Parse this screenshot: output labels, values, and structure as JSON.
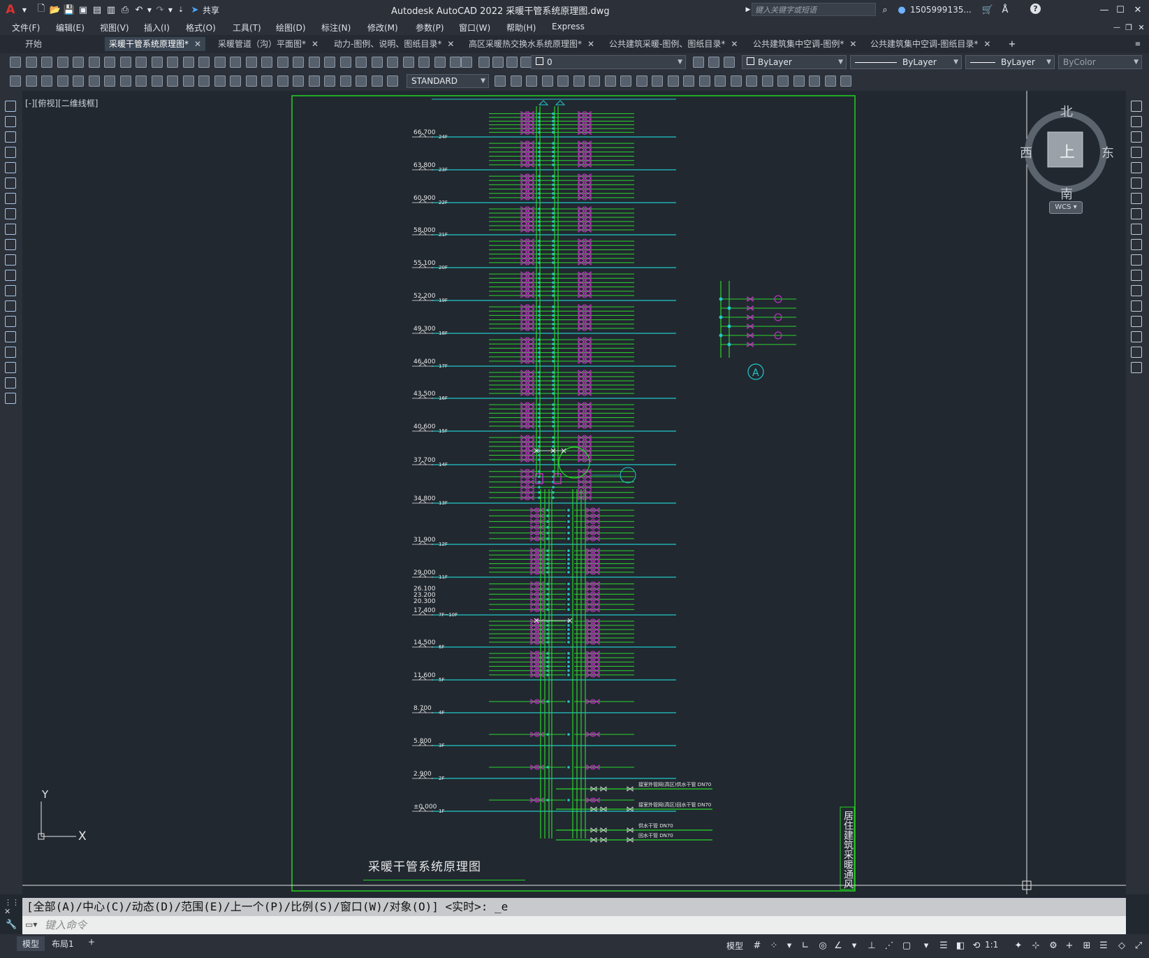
{
  "app": {
    "title": "Autodesk AutoCAD 2022    采暖干管系统原理图.dwg",
    "share_label": "共享",
    "search_placeholder": "键入关键字或短语",
    "user": "1505999135...",
    "logo": "A"
  },
  "menu": [
    "文件(F)",
    "编辑(E)",
    "视图(V)",
    "插入(I)",
    "格式(O)",
    "工具(T)",
    "绘图(D)",
    "标注(N)",
    "修改(M)",
    "参数(P)",
    "窗口(W)",
    "帮助(H)",
    "Express"
  ],
  "tabs": [
    {
      "label": "开始"
    },
    {
      "label": "采暖干管系统原理图*"
    },
    {
      "label": "采暖管道（沟）平面图*"
    },
    {
      "label": "动力-图例、说明、图纸目录*"
    },
    {
      "label": "高区采暖热交换水系统原理图*"
    },
    {
      "label": "公共建筑采暖-图例、图纸目录*"
    },
    {
      "label": "公共建筑集中空调-图例*"
    },
    {
      "label": "公共建筑集中空调-图纸目录*"
    }
  ],
  "toolbar": {
    "layer_value": "0",
    "color_value": "ByLayer",
    "linetype_value": "ByLayer",
    "lineweight_value": "ByLayer",
    "plotstyle_value": "ByColor",
    "textstyle_value": "STANDARD"
  },
  "viewport": {
    "label": "[-][俯视][二维线框]",
    "viewcube": {
      "north": "北",
      "south": "南",
      "east": "东",
      "west": "西",
      "top": "上",
      "wcs": "WCS"
    },
    "ucs": {
      "x": "X",
      "y": "Y"
    }
  },
  "drawing": {
    "title": "采暖干管系统原理图",
    "side_title": "居住建筑采暖通风",
    "detail_label": "A",
    "levels": [
      {
        "elev": "66.700",
        "floor": "24F"
      },
      {
        "elev": "63.800",
        "floor": "23F"
      },
      {
        "elev": "60.900",
        "floor": "22F"
      },
      {
        "elev": "58.000",
        "floor": "21F"
      },
      {
        "elev": "55.100",
        "floor": "20F"
      },
      {
        "elev": "52.200",
        "floor": "19F"
      },
      {
        "elev": "49.300",
        "floor": "18F"
      },
      {
        "elev": "46.400",
        "floor": "17F"
      },
      {
        "elev": "43.500",
        "floor": "16F"
      },
      {
        "elev": "40.600",
        "floor": "15F"
      },
      {
        "elev": "37.700",
        "floor": "14F"
      },
      {
        "elev": "34.800",
        "floor": "13F"
      },
      {
        "elev": "31.900",
        "floor": "12F"
      },
      {
        "elev": "29.000",
        "floor": "11F"
      },
      {
        "elev": "17.400",
        "floor": "7F~10F",
        "extra": [
          "26.100",
          "23.200",
          "20.300"
        ]
      },
      {
        "elev": "14.500",
        "floor": "6F"
      },
      {
        "elev": "11.600",
        "floor": "5F"
      },
      {
        "elev": "8.700",
        "floor": "4F"
      },
      {
        "elev": "5.800",
        "floor": "3F"
      },
      {
        "elev": "2.900",
        "floor": "2F"
      },
      {
        "elev": "±0.000",
        "floor": "1F"
      }
    ],
    "pipe_labels": [
      "接室外管网(高区)供水干管 DN70",
      "接室外管网(高区)回水干管 DN70",
      "供水干管 DN70",
      "回水干管 DN70"
    ]
  },
  "command": {
    "prompt": "[全部(A)/中心(C)/动态(D)/范围(E)/上一个(P)/比例(S)/窗口(W)/对象(O)] <实时>: _e",
    "input_placeholder": "键入命令"
  },
  "status": {
    "layout_tabs": [
      "模型",
      "布局1"
    ],
    "model_label": "模型",
    "scale": "1:1"
  },
  "colors": {
    "background": "#212830",
    "frame_green": "#22d322",
    "pipe_green": "#2bd62b",
    "level_cyan": "#22c8c8",
    "valve_magenta": "#d633d6",
    "text_white": "#e8e8e8"
  }
}
